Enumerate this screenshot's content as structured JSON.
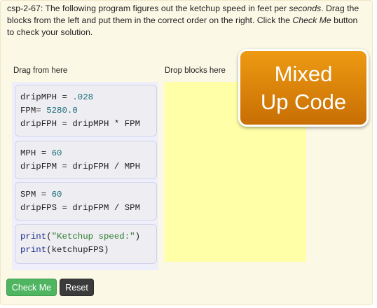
{
  "instructions": {
    "prefix": "csp-2-67: The following program figures out the ketchup speed in feet per ",
    "emphasis1": "seconds",
    "middle": ". Drag the blocks from the left and put them in the correct order on the right. Click the ",
    "emphasis2": "Check Me",
    "suffix": " button to check your solution."
  },
  "labels": {
    "drag_from": "Drag from here",
    "drop_blocks": "Drop blocks here"
  },
  "badge": {
    "line1": "Mixed",
    "line2": "Up Code"
  },
  "blocks": [
    {
      "lines": [
        [
          {
            "t": "dripMPH = "
          },
          {
            "t": ".028",
            "c": "num"
          }
        ],
        [
          {
            "t": "FPM= "
          },
          {
            "t": "5280.0",
            "c": "num"
          }
        ],
        [
          {
            "t": "dripFPH = dripMPH * FPM"
          }
        ]
      ]
    },
    {
      "lines": [
        [
          {
            "t": "MPH = "
          },
          {
            "t": "60",
            "c": "num"
          }
        ],
        [
          {
            "t": "dripFPM = dripFPH / MPH"
          }
        ]
      ]
    },
    {
      "lines": [
        [
          {
            "t": "SPM = "
          },
          {
            "t": "60",
            "c": "num"
          }
        ],
        [
          {
            "t": "dripFPS = dripFPM / SPM"
          }
        ]
      ]
    },
    {
      "lines": [
        [
          {
            "t": "print",
            "c": "kw"
          },
          {
            "t": "("
          },
          {
            "t": "\"Ketchup speed:\"",
            "c": "str"
          },
          {
            "t": ")"
          }
        ],
        [
          {
            "t": "print",
            "c": "kw"
          },
          {
            "t": "(ketchupFPS)"
          }
        ]
      ]
    }
  ],
  "buttons": {
    "check_me": "Check Me",
    "reset": "Reset"
  }
}
